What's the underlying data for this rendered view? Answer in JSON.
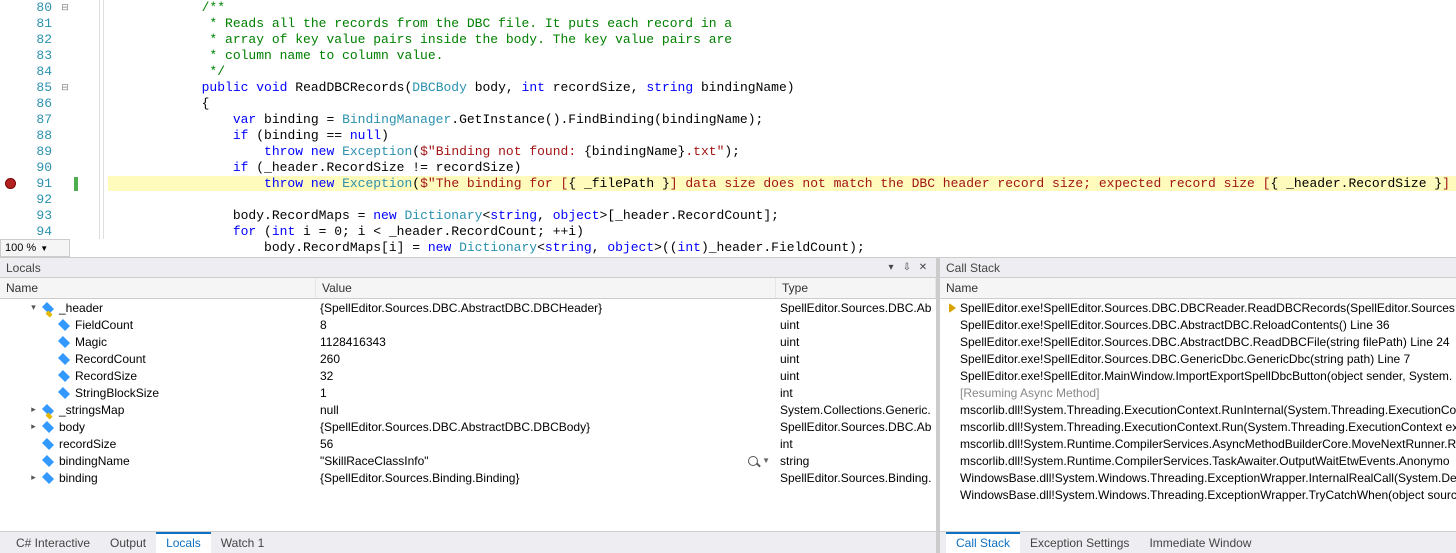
{
  "editor": {
    "zoom": "100 %",
    "breakpoint_line": 91,
    "lines": [
      {
        "n": 80,
        "fold": "-",
        "html": "            <span class='cmt'>/**</span>"
      },
      {
        "n": 81,
        "fold": "",
        "html": "             <span class='cmt'>* Reads all the records from the DBC file. It puts each record in a</span>"
      },
      {
        "n": 82,
        "fold": "",
        "html": "             <span class='cmt'>* array of key value pairs inside the body. The key value pairs are</span>"
      },
      {
        "n": 83,
        "fold": "",
        "html": "             <span class='cmt'>* column name to column value.</span>"
      },
      {
        "n": 84,
        "fold": "",
        "html": "             <span class='cmt'>*/</span>"
      },
      {
        "n": 85,
        "fold": "-",
        "html": "            <span class='kw'>public</span> <span class='kw'>void</span> ReadDBCRecords(<span class='type'>DBCBody</span> body, <span class='kw'>int</span> recordSize, <span class='kw'>string</span> bindingName)"
      },
      {
        "n": 86,
        "fold": "",
        "html": "            {"
      },
      {
        "n": 87,
        "fold": "",
        "html": "                <span class='kw'>var</span> binding = <span class='type'>BindingManager</span>.GetInstance().FindBinding(bindingName);"
      },
      {
        "n": 88,
        "fold": "",
        "html": "                <span class='kw'>if</span> (binding == <span class='kw'>null</span>)"
      },
      {
        "n": 89,
        "fold": "",
        "html": "                    <span class='kw'>throw</span> <span class='kw'>new</span> <span class='type'>Exception</span>(<span class='str'>$\"Binding not found: </span>{bindingName}<span class='str'>.txt\"</span>);"
      },
      {
        "n": 90,
        "fold": "",
        "html": "                <span class='kw'>if</span> (_header.RecordSize != recordSize)"
      },
      {
        "n": 91,
        "fold": "",
        "exec": true,
        "html": "<span class='hl'>                    <span class='kw'>throw</span> <span class='kw'>new</span> <span class='type'>Exception</span>(<span class='str'>$\"The binding for [</span>{ _filePath }<span class='str'>] data size does not match the DBC header record size; expected record size [</span>{ _header.RecordSize }<span class='str'>] got [</span>{ recordSize }<span class='str'>].\"</span>);</span>"
      },
      {
        "n": 92,
        "fold": "",
        "html": ""
      },
      {
        "n": 93,
        "fold": "",
        "html": "                body.RecordMaps = <span class='kw'>new</span> <span class='type'>Dictionary</span>&lt;<span class='kw'>string</span>, <span class='kw'>object</span>&gt;[_header.RecordCount];"
      },
      {
        "n": 94,
        "fold": "",
        "html": "                <span class='kw'>for</span> (<span class='kw'>int</span> i = 0; i &lt; _header.RecordCount; ++i)"
      },
      {
        "n": 95,
        "fold": "",
        "html": "                    body.RecordMaps[i] = <span class='kw'>new</span> <span class='type'>Dictionary</span>&lt;<span class='kw'>string</span>, <span class='kw'>object</span>&gt;((<span class='kw'>int</span>)_header.FieldCount);"
      }
    ]
  },
  "locals": {
    "title": "Locals",
    "cols": {
      "name": "Name",
      "value": "Value",
      "type": "Type"
    },
    "rows": [
      {
        "indent": 1,
        "exp": "▾",
        "icon": "cube-lock",
        "name": "_header",
        "value": "{SpellEditor.Sources.DBC.AbstractDBC.DBCHeader}",
        "type": "SpellEditor.Sources.DBC.Ab"
      },
      {
        "indent": 2,
        "exp": "",
        "icon": "cube",
        "name": "FieldCount",
        "value": "8",
        "type": "uint"
      },
      {
        "indent": 2,
        "exp": "",
        "icon": "cube",
        "name": "Magic",
        "value": "1128416343",
        "type": "uint"
      },
      {
        "indent": 2,
        "exp": "",
        "icon": "cube",
        "name": "RecordCount",
        "value": "260",
        "type": "uint"
      },
      {
        "indent": 2,
        "exp": "",
        "icon": "cube",
        "name": "RecordSize",
        "value": "32",
        "type": "uint"
      },
      {
        "indent": 2,
        "exp": "",
        "icon": "cube",
        "name": "StringBlockSize",
        "value": "1",
        "type": "int"
      },
      {
        "indent": 1,
        "exp": "▸",
        "icon": "cube-lock",
        "name": "_stringsMap",
        "value": "null",
        "type": "System.Collections.Generic."
      },
      {
        "indent": 1,
        "exp": "▸",
        "icon": "cube",
        "name": "body",
        "value": "{SpellEditor.Sources.DBC.AbstractDBC.DBCBody}",
        "type": "SpellEditor.Sources.DBC.Ab"
      },
      {
        "indent": 1,
        "exp": "",
        "icon": "cube",
        "name": "recordSize",
        "value": "56",
        "type": "int"
      },
      {
        "indent": 1,
        "exp": "",
        "icon": "cube",
        "name": "bindingName",
        "value": "\"SkillRaceClassInfo\"",
        "type": "string",
        "mag": true
      },
      {
        "indent": 1,
        "exp": "▸",
        "icon": "cube",
        "name": "binding",
        "value": "{SpellEditor.Sources.Binding.Binding}",
        "type": "SpellEditor.Sources.Binding."
      }
    ],
    "tabs": [
      "C# Interactive",
      "Output",
      "Locals",
      "Watch 1"
    ],
    "active_tab": "Locals"
  },
  "callstack": {
    "title": "Call Stack",
    "col": "Name",
    "rows": [
      {
        "marker": true,
        "text": "SpellEditor.exe!SpellEditor.Sources.DBC.DBCReader.ReadDBCRecords(SpellEditor.Sources.DBC"
      },
      {
        "text": "SpellEditor.exe!SpellEditor.Sources.DBC.AbstractDBC.ReloadContents() Line 36"
      },
      {
        "text": "SpellEditor.exe!SpellEditor.Sources.DBC.AbstractDBC.ReadDBCFile(string filePath) Line 24"
      },
      {
        "text": "SpellEditor.exe!SpellEditor.Sources.DBC.GenericDbc.GenericDbc(string path) Line 7"
      },
      {
        "text": "SpellEditor.exe!SpellEditor.MainWindow.ImportExportSpellDbcButton(object sender, System."
      },
      {
        "meta": true,
        "text": "[Resuming Async Method]"
      },
      {
        "text": "mscorlib.dll!System.Threading.ExecutionContext.RunInternal(System.Threading.ExecutionCo"
      },
      {
        "text": "mscorlib.dll!System.Threading.ExecutionContext.Run(System.Threading.ExecutionContext ex"
      },
      {
        "text": "mscorlib.dll!System.Runtime.CompilerServices.AsyncMethodBuilderCore.MoveNextRunner.R"
      },
      {
        "text": "mscorlib.dll!System.Runtime.CompilerServices.TaskAwaiter.OutputWaitEtwEvents.Anonymo"
      },
      {
        "text": "WindowsBase.dll!System.Windows.Threading.ExceptionWrapper.InternalRealCall(System.Del"
      },
      {
        "text": "WindowsBase.dll!System.Windows.Threading.ExceptionWrapper.TryCatchWhen(object sourc"
      }
    ],
    "tabs": [
      "Call Stack",
      "Exception Settings",
      "Immediate Window"
    ],
    "active_tab": "Call Stack"
  }
}
